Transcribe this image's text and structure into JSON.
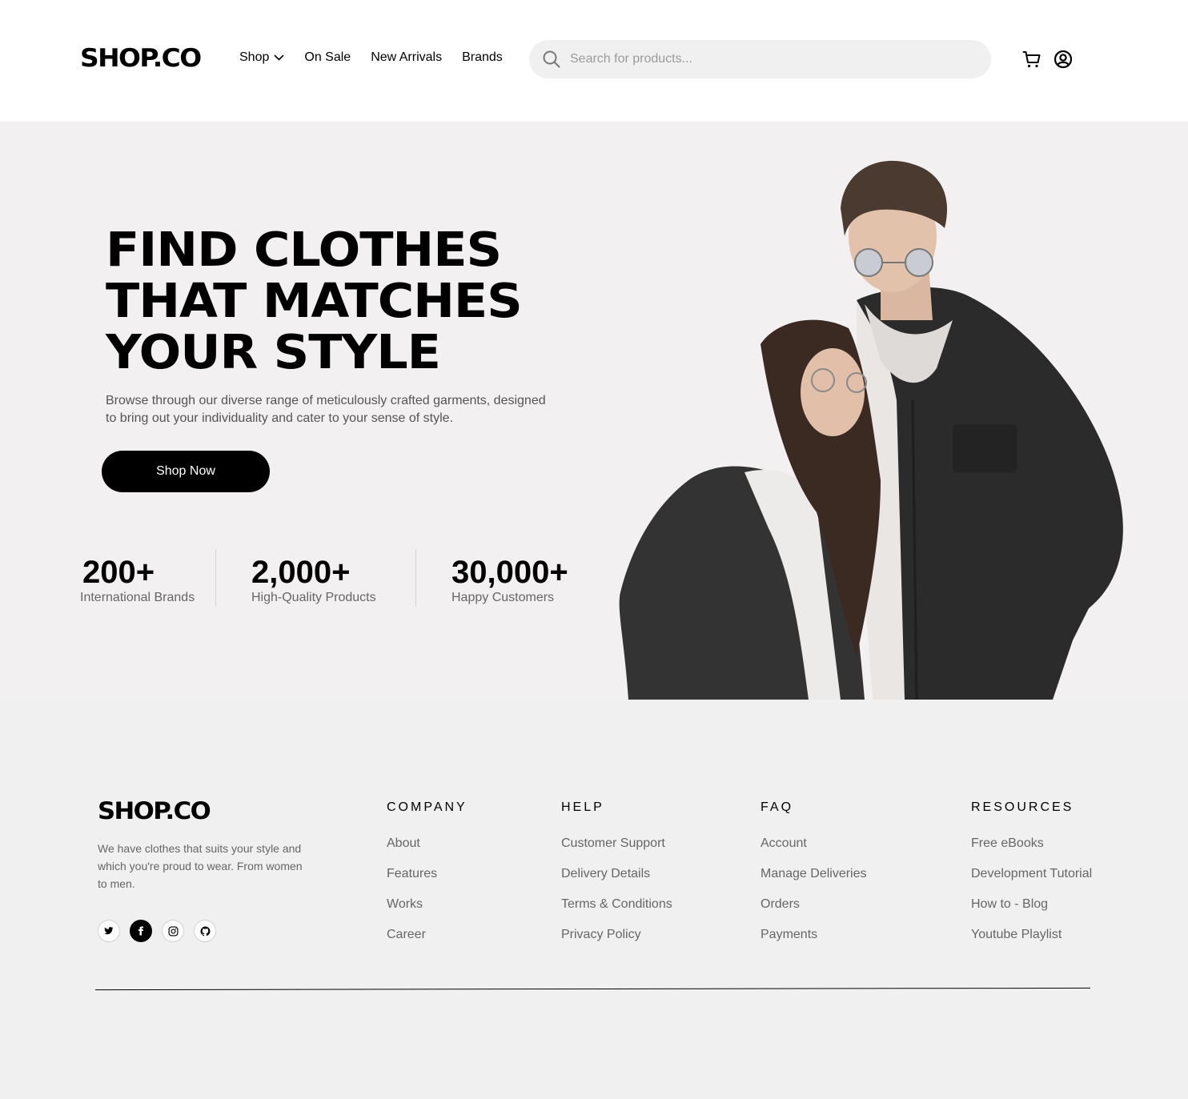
{
  "header": {
    "logo": "SHOP.CO",
    "nav": [
      {
        "label": "Shop",
        "has_dropdown": true
      },
      {
        "label": "On Sale"
      },
      {
        "label": "New Arrivals"
      },
      {
        "label": "Brands"
      }
    ],
    "search_placeholder": "Search for products...",
    "icons": [
      "search-icon",
      "cart-icon",
      "user-account-icon",
      "chevron-down-icon"
    ]
  },
  "hero": {
    "title_lines": [
      "FIND CLOTHES",
      "THAT MATCHES",
      "YOUR STYLE"
    ],
    "description": "Browse through our diverse range of meticulously crafted garments, designed to bring out your individuality and cater to your sense of style.",
    "cta_label": "Shop Now",
    "stats": [
      {
        "value": "200+",
        "label": "International Brands"
      },
      {
        "value": "2,000+",
        "label": "High-Quality Products"
      },
      {
        "value": "30,000+",
        "label": "Happy Customers"
      }
    ]
  },
  "footer": {
    "logo": "SHOP.CO",
    "description": "We have clothes that suits your style and which you're proud to wear. From women to men.",
    "socials": [
      "twitter-icon",
      "facebook-icon",
      "instagram-icon",
      "github-icon"
    ],
    "columns": [
      {
        "heading": "COMPANY",
        "links": [
          "About",
          "Features",
          "Works",
          "Career"
        ]
      },
      {
        "heading": "HELP",
        "links": [
          "Customer Support",
          "Delivery Details",
          "Terms & Conditions",
          "Privacy Policy"
        ]
      },
      {
        "heading": "FAQ",
        "links": [
          "Account",
          "Manage Deliveries",
          "Orders",
          "Payments"
        ]
      },
      {
        "heading": "RESOURCES",
        "links": [
          "Free eBooks",
          "Development Tutorial",
          "How to - Blog",
          "Youtube Playlist"
        ]
      }
    ]
  },
  "colors": {
    "primary": "#000000",
    "hero_bg": "#f2f0f1",
    "footer_bg": "#f0f0f0",
    "search_bg": "#f0f0f0",
    "muted_text": "#666666"
  }
}
